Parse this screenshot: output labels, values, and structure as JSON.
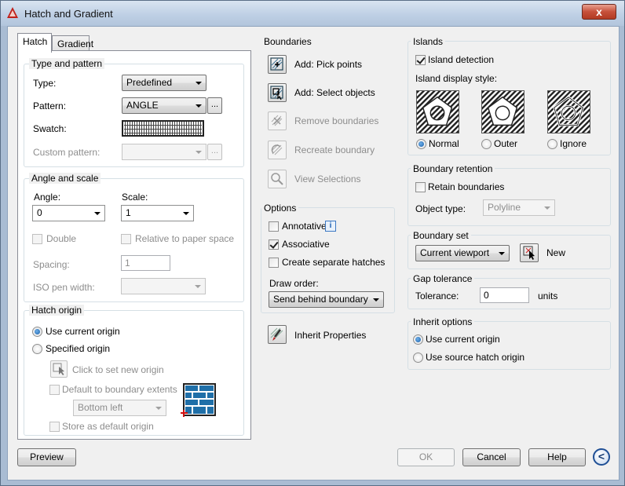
{
  "window": {
    "title": "Hatch and Gradient",
    "close_label": "x"
  },
  "tabs": [
    {
      "label": "Hatch"
    },
    {
      "label": "Gradient"
    }
  ],
  "type_and_pattern": {
    "title": "Type and pattern",
    "type_label": "Type:",
    "type_value": "Predefined",
    "pattern_label": "Pattern:",
    "pattern_value": "ANGLE",
    "swatch_label": "Swatch:",
    "custom_pattern_label": "Custom pattern:",
    "ellipsis": "..."
  },
  "angle_and_scale": {
    "title": "Angle and scale",
    "angle_label": "Angle:",
    "angle_value": "0",
    "scale_label": "Scale:",
    "scale_value": "1",
    "double_label": "Double",
    "relative_label": "Relative to paper space",
    "spacing_label": "Spacing:",
    "spacing_value": "1",
    "iso_label": "ISO pen width:"
  },
  "hatch_origin": {
    "title": "Hatch origin",
    "use_current": "Use current origin",
    "specified": "Specified origin",
    "click_to_set": "Click to set new origin",
    "default_extents": "Default to boundary extents",
    "extent_value": "Bottom left",
    "store_default": "Store as default origin"
  },
  "boundaries": {
    "title": "Boundaries",
    "pick_points": "Add: Pick points",
    "select_objects": "Add: Select objects",
    "remove": "Remove boundaries",
    "recreate": "Recreate boundary",
    "view": "View Selections"
  },
  "options": {
    "title": "Options",
    "annotative": "Annotative",
    "associative": "Associative",
    "separate": "Create separate hatches",
    "draw_order_label": "Draw order:",
    "draw_order_value": "Send behind boundary"
  },
  "inherit_properties": "Inherit Properties",
  "islands": {
    "title": "Islands",
    "detection": "Island detection",
    "style_label": "Island display style:",
    "normal": "Normal",
    "outer": "Outer",
    "ignore": "Ignore"
  },
  "boundary_retention": {
    "title": "Boundary retention",
    "retain": "Retain boundaries",
    "object_type_label": "Object type:",
    "object_type_value": "Polyline"
  },
  "boundary_set": {
    "title": "Boundary set",
    "value": "Current viewport",
    "new_label": "New"
  },
  "gap_tolerance": {
    "title": "Gap tolerance",
    "tolerance_label": "Tolerance:",
    "tolerance_value": "0",
    "units": "units"
  },
  "inherit_options": {
    "title": "Inherit options",
    "use_current": "Use current origin",
    "use_source": "Use source hatch origin"
  },
  "footer": {
    "preview": "Preview",
    "ok": "OK",
    "cancel": "Cancel",
    "help": "Help",
    "collapse": "<"
  }
}
